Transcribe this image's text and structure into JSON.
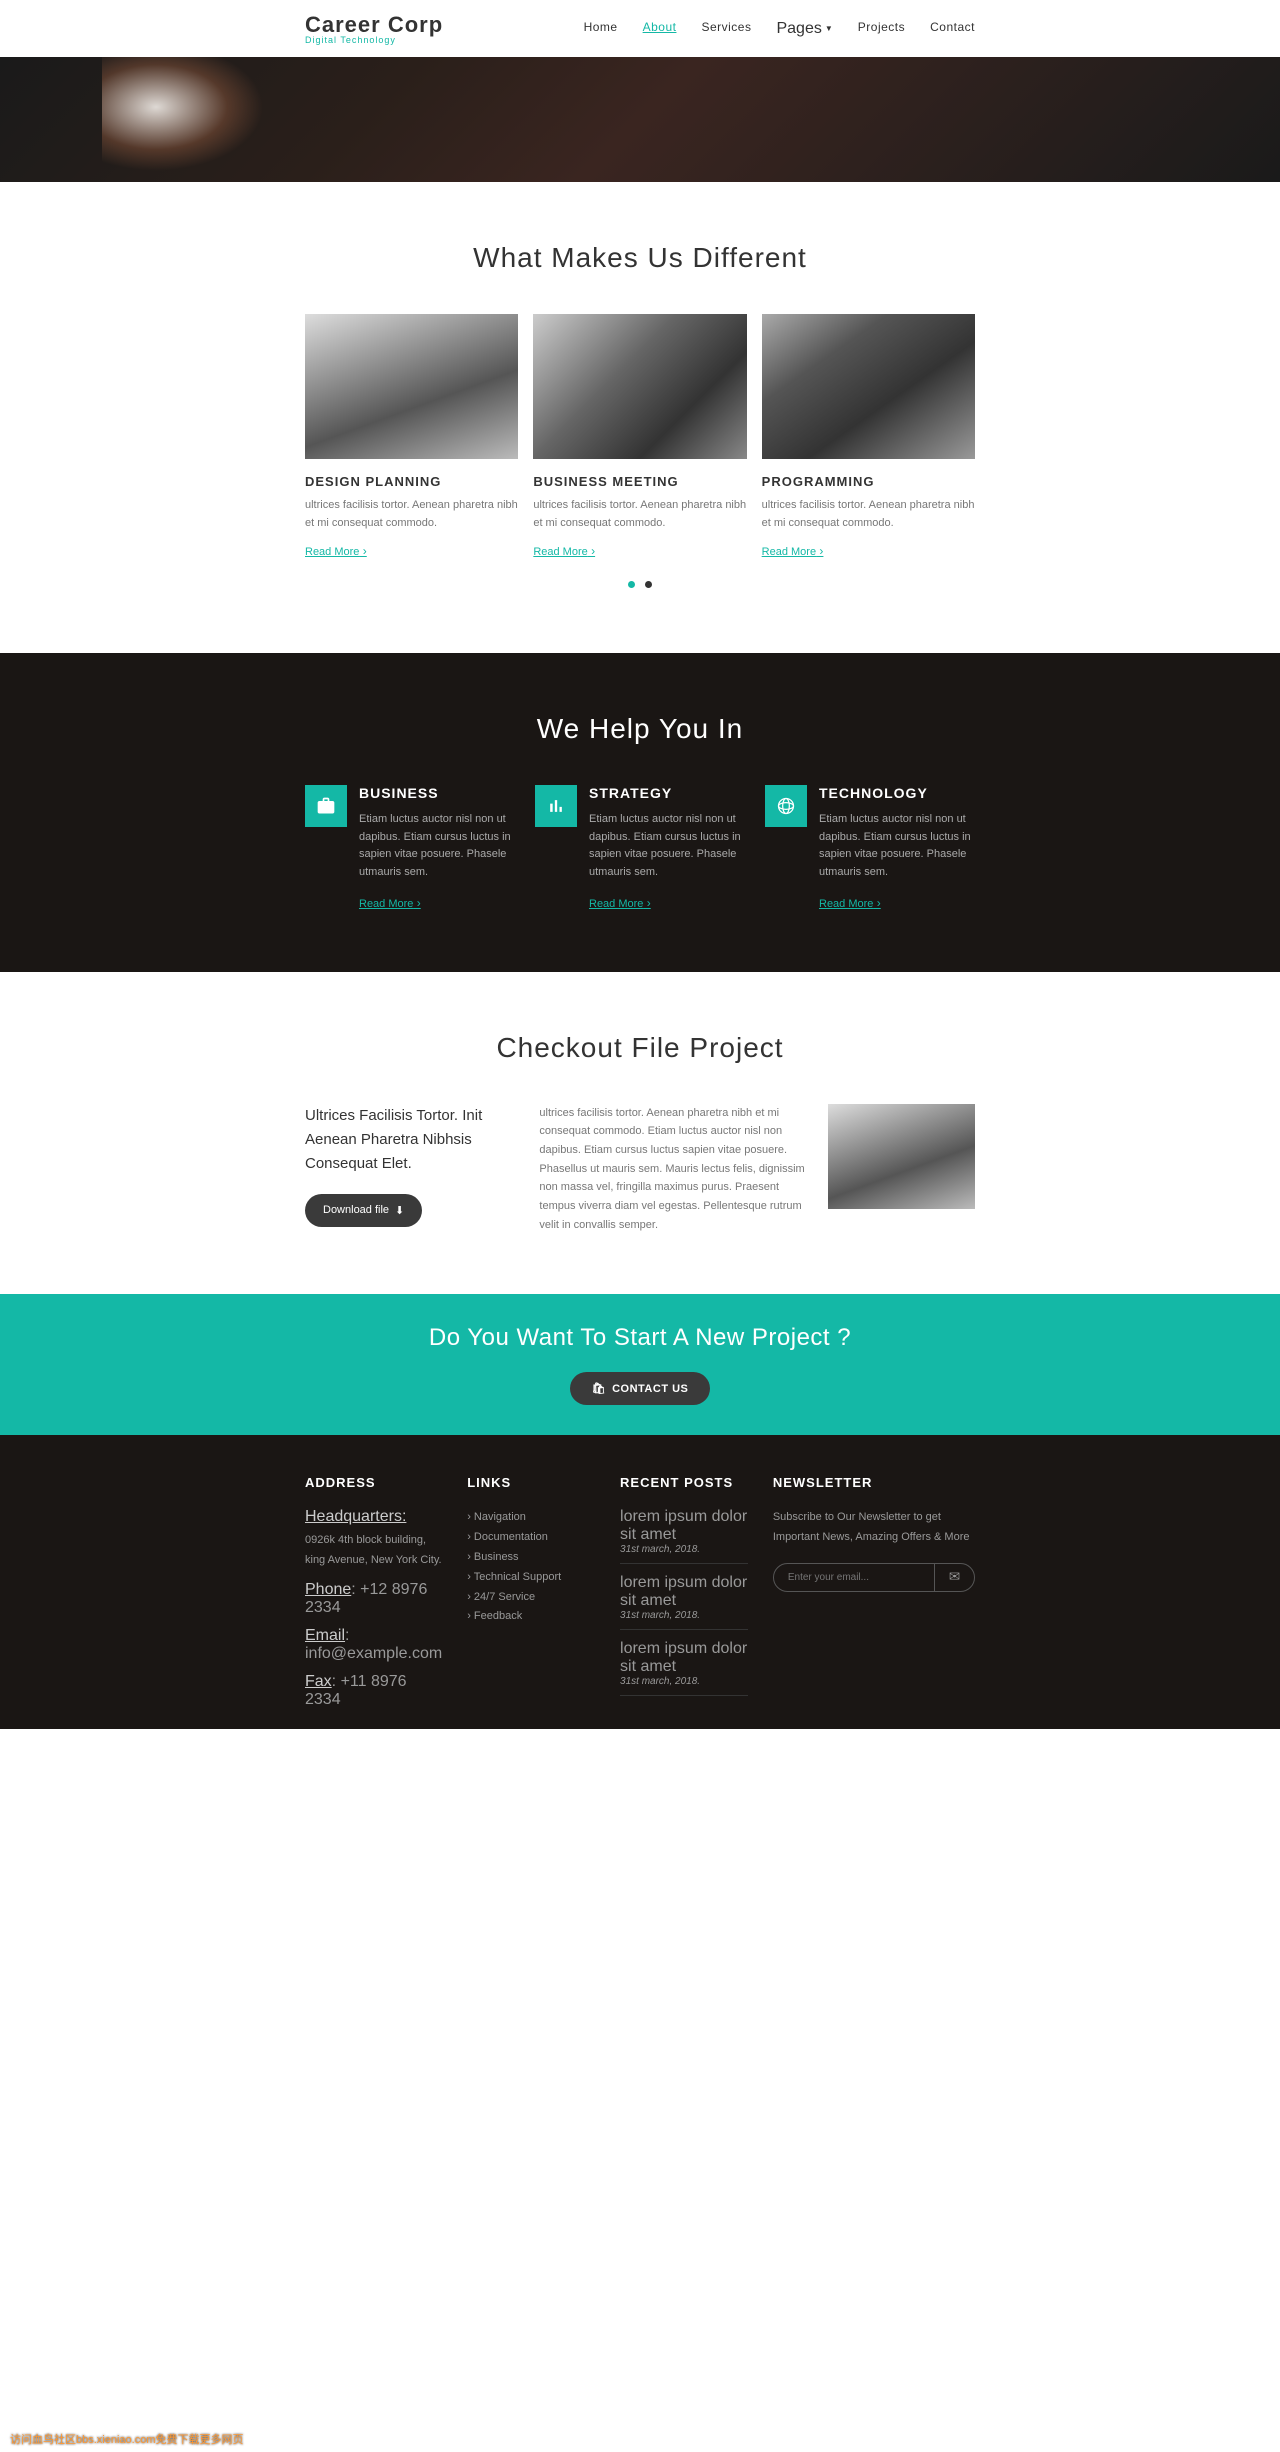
{
  "logo": {
    "name": "Career Corp",
    "tagline": "Digital Technology"
  },
  "nav": {
    "home": "Home",
    "about": "About",
    "services": "Services",
    "pages": "Pages",
    "projects": "Projects",
    "contact": "Contact"
  },
  "different": {
    "title": "What Makes Us Different",
    "cards": [
      {
        "title": "DESIGN PLANNING",
        "text": "ultrices facilisis tortor. Aenean pharetra nibh et mi consequat commodo.",
        "link": "Read More"
      },
      {
        "title": "BUSINESS MEETING",
        "text": "ultrices facilisis tortor. Aenean pharetra nibh et mi consequat commodo.",
        "link": "Read More"
      },
      {
        "title": "PROGRAMMING",
        "text": "ultrices facilisis tortor. Aenean pharetra nibh et mi consequat commodo.",
        "link": "Read More"
      }
    ]
  },
  "help": {
    "title": "We Help You In",
    "cards": [
      {
        "title": "BUSINESS",
        "text": "Etiam luctus auctor nisl non ut dapibus. Etiam cursus luctus in sapien vitae posuere. Phasele utmauris sem.",
        "link": "Read More"
      },
      {
        "title": "STRATEGY",
        "text": "Etiam luctus auctor nisl non ut dapibus. Etiam cursus luctus in sapien vitae posuere. Phasele utmauris sem.",
        "link": "Read More"
      },
      {
        "title": "TECHNOLOGY",
        "text": "Etiam luctus auctor nisl non ut dapibus. Etiam cursus luctus in sapien vitae posuere. Phasele utmauris sem.",
        "link": "Read More"
      }
    ]
  },
  "checkout": {
    "title": "Checkout File Project",
    "heading": "Ultrices Facilisis Tortor. Init Aenean Pharetra Nibhsis Consequat Elet.",
    "text": "ultrices facilisis tortor. Aenean pharetra nibh et mi consequat commodo. Etiam luctus auctor nisl non dapibus. Etiam cursus luctus sapien vitae posuere. Phasellus ut mauris sem. Mauris lectus felis, dignissim non massa vel, fringilla maximus purus. Praesent tempus viverra diam vel egestas. Pellentesque rutrum velit in convallis semper.",
    "button": "Download file"
  },
  "cta": {
    "title": "Do You Want To Start A New Project ?",
    "button": "CONTACT US"
  },
  "footer": {
    "address": {
      "title": "ADDRESS",
      "hq": "Headquarters:",
      "line1": "0926k 4th block building, king Avenue, New York City.",
      "phone_label": "Phone",
      "phone": ": +12 8976 2334",
      "email_label": "Email",
      "email": ": info@example.com",
      "fax_label": "Fax",
      "fax": ": +11 8976 2334"
    },
    "links": {
      "title": "LINKS",
      "items": [
        "Navigation",
        "Documentation",
        "Business",
        "Technical Support",
        "24/7 Service",
        "Feedback"
      ]
    },
    "posts": {
      "title": "RECENT POSTS",
      "items": [
        {
          "text": "lorem ipsum dolor sit amet",
          "date": "31st march, 2018."
        },
        {
          "text": "lorem ipsum dolor sit amet",
          "date": "31st march, 2018."
        },
        {
          "text": "lorem ipsum dolor sit amet",
          "date": "31st march, 2018."
        }
      ]
    },
    "newsletter": {
      "title": "NEWSLETTER",
      "text": "Subscribe to Our Newsletter to get Important News, Amazing Offers & More",
      "placeholder": "Enter your email..."
    }
  },
  "watermark": "访问血鸟社区bbs.xieniao.com免费下载更多网页"
}
